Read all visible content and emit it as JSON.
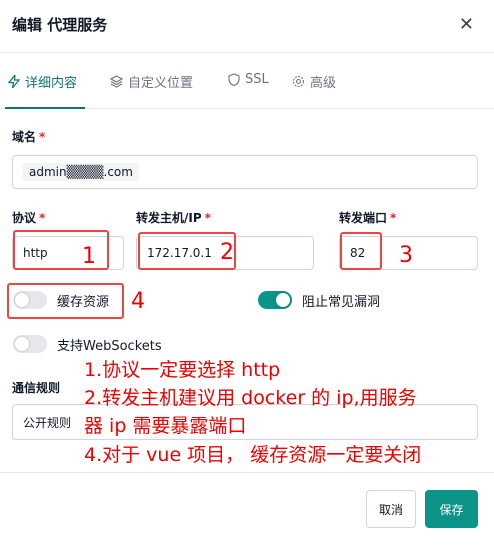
{
  "dialog": {
    "title": "编辑 代理服务",
    "close_glyph": "✕"
  },
  "tabs": [
    {
      "label": "详细内容",
      "icon": "lightning-icon",
      "active": true
    },
    {
      "label": "自定义位置",
      "icon": "layers-icon",
      "active": false
    },
    {
      "label": "SSL",
      "icon": "shield-icon",
      "active": false
    },
    {
      "label": "高级",
      "icon": "gear-icon",
      "active": false
    }
  ],
  "form": {
    "domain": {
      "label": "域名",
      "required": "*",
      "value": "admin▒▒▒▒.com"
    },
    "protocol": {
      "label": "协议",
      "required": "*",
      "value": "http"
    },
    "forward_host": {
      "label": "转发主机/IP",
      "required": "*",
      "value": "172.17.0.1"
    },
    "forward_port": {
      "label": "转发端口",
      "required": "*",
      "value": "82"
    },
    "cache_assets": {
      "label": "缓存资源",
      "on": false
    },
    "block_exploits": {
      "label": "阻止常见漏洞",
      "on": true
    },
    "websockets": {
      "label": "支持WebSockets",
      "on": false
    },
    "access_rule": {
      "label": "通信规则",
      "value": "公开规则"
    }
  },
  "annotations": {
    "num1": "1",
    "num2": "2",
    "num3": "3",
    "num4": "4",
    "lines": [
      "1.协议一定要选择 http",
      "2.转发主机建议用 docker 的 ip,用服务",
      "器 ip 需要暴露端口",
      "4.对于 vue 项目， 缓存资源一定要关闭"
    ]
  },
  "footer": {
    "cancel_label": "取消",
    "save_label": "保存"
  },
  "colors": {
    "accent": "#0d9488",
    "annotation": "#ef0000"
  }
}
